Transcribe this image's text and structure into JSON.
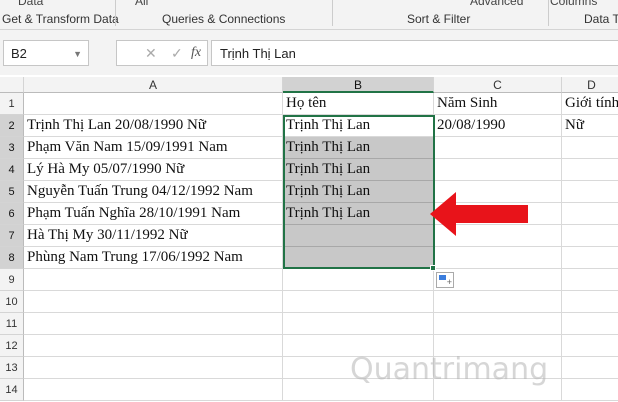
{
  "ribbon": {
    "top_items": [
      "Data",
      "All",
      "Advanced",
      "Columns"
    ],
    "groups": [
      "Get & Transform Data",
      "Queries & Connections",
      "Sort & Filter",
      "Data Tools"
    ]
  },
  "formula_bar": {
    "name_box": "B2",
    "cancel": "✕",
    "enter": "✓",
    "fx": "fx",
    "value": "Trịnh Thị Lan"
  },
  "columns": [
    "A",
    "B",
    "C",
    "D"
  ],
  "rows": [
    "1",
    "2",
    "3",
    "4",
    "5",
    "6",
    "7",
    "8",
    "9",
    "10",
    "11",
    "12",
    "13",
    "14"
  ],
  "cells": {
    "A": [
      "",
      "Trịnh Thị Lan 20/08/1990 Nữ",
      "Phạm Văn Nam 15/09/1991 Nam",
      "Lý Hà My 05/07/1990 Nữ",
      "Nguyễn Tuấn Trung 04/12/1992 Nam",
      "Phạm Tuấn Nghĩa 28/10/1991 Nam",
      "Hà Thị My 30/11/1992 Nữ",
      "Phùng Nam Trung 17/06/1992 Nam"
    ],
    "B": [
      "Họ tên",
      "Trịnh Thị Lan",
      "Trịnh Thị Lan",
      "Trịnh Thị Lan",
      "Trịnh Thị Lan",
      "Trịnh Thị Lan",
      "",
      ""
    ],
    "C": [
      "Năm Sinh",
      "20/08/1990"
    ],
    "D": [
      "Giới tính",
      "Nữ"
    ]
  },
  "watermark": "Quantrimang",
  "colors": {
    "accent": "#217346",
    "arrow": "#e8131a",
    "fill": "#c8c8c8"
  }
}
